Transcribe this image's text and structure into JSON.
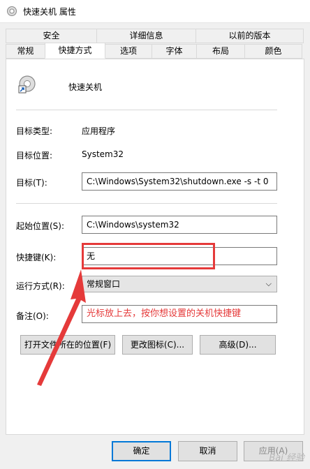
{
  "window": {
    "title": "快速关机 属性"
  },
  "tabs": {
    "top": [
      "安全",
      "详细信息",
      "以前的版本"
    ],
    "bottom": [
      "常规",
      "快捷方式",
      "选项",
      "字体",
      "布局",
      "颜色"
    ],
    "selected": "快捷方式"
  },
  "shortcut": {
    "name": "快速关机",
    "target_type_label": "目标类型:",
    "target_type_value": "应用程序",
    "target_location_label": "目标位置:",
    "target_location_value": "System32",
    "target_label": "目标(T):",
    "target_value": "C:\\Windows\\System32\\shutdown.exe -s -t 0",
    "start_in_label": "起始位置(S):",
    "start_in_value": "C:\\Windows\\system32",
    "hotkey_label": "快捷键(K):",
    "hotkey_value": "无",
    "run_label": "运行方式(R):",
    "run_value": "常规窗口",
    "comment_label": "备注(O):",
    "comment_value": "光标放上去，按你想设置的关机快捷键"
  },
  "buttons": {
    "open_location": "打开文件所在的位置(F)",
    "change_icon": "更改图标(C)...",
    "advanced": "高级(D)...",
    "ok": "确定",
    "cancel": "取消",
    "apply": "应用(A)"
  },
  "watermark": "Bai 经验",
  "colors": {
    "annotation": "#e53a3a",
    "comment_text": "#e53a3a"
  }
}
